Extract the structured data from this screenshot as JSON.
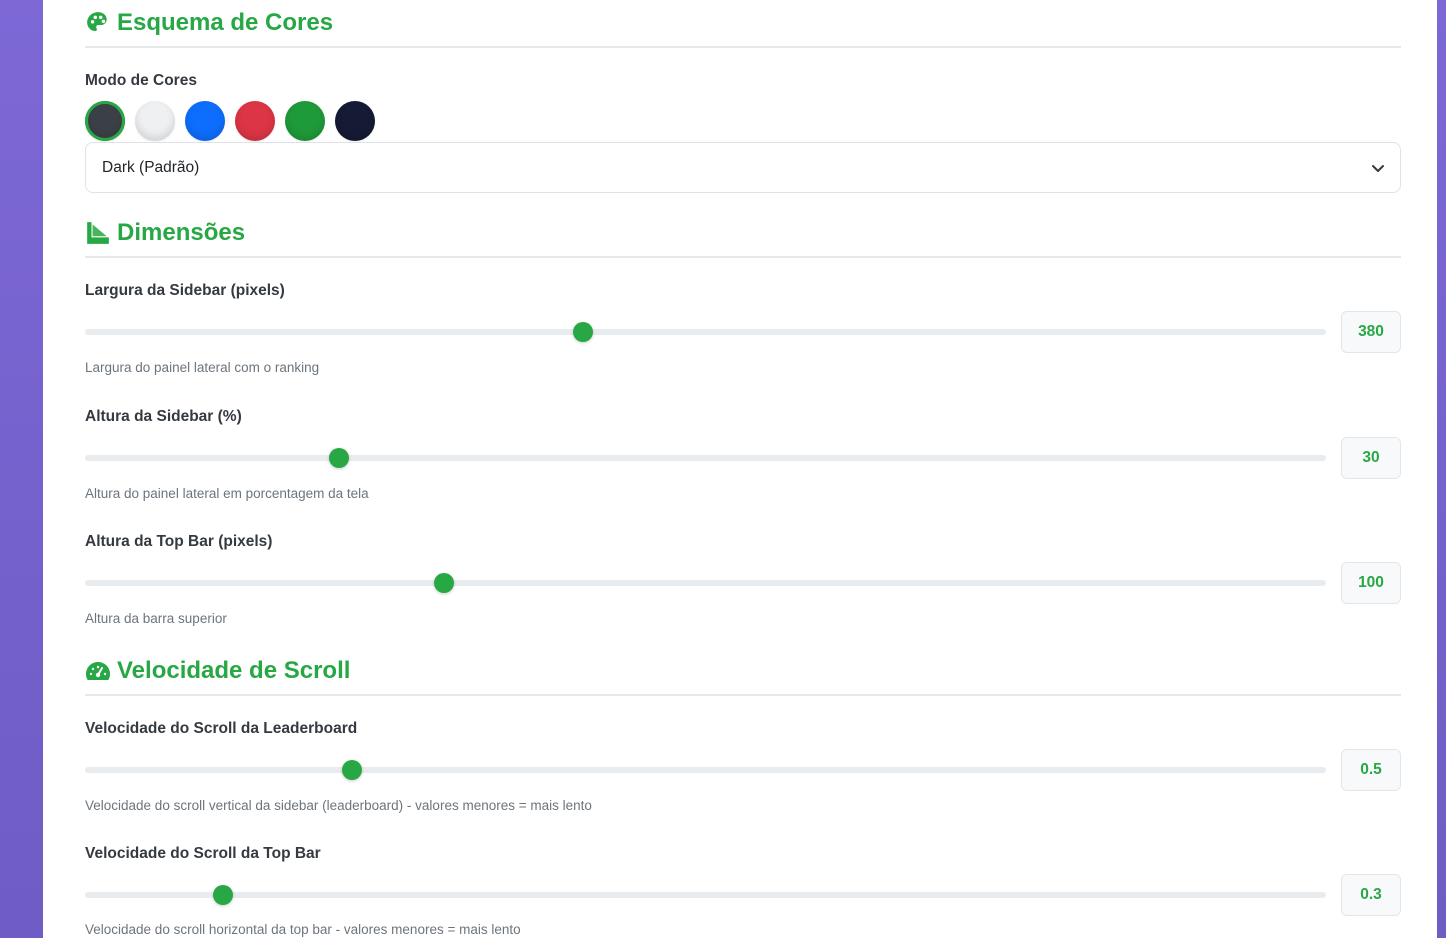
{
  "colors": {
    "accent": "#28a745",
    "background_gradient": "#7d68d6"
  },
  "color_scheme": {
    "title": "Esquema de Cores",
    "icon": "palette-icon",
    "mode_label": "Modo de Cores",
    "swatches": [
      {
        "name": "dark",
        "color": "#3b3f46",
        "selected": true
      },
      {
        "name": "light",
        "color": "#eef0f2",
        "selected": false
      },
      {
        "name": "blue",
        "color": "#0d6efd",
        "selected": false
      },
      {
        "name": "red",
        "color": "#dc3545",
        "selected": false
      },
      {
        "name": "green",
        "color": "#1f9a3a",
        "selected": false
      },
      {
        "name": "navy",
        "color": "#151b34",
        "selected": false
      }
    ],
    "select_value": "Dark (Padrão)"
  },
  "dimensions": {
    "title": "Dimensões",
    "icon": "ruler-icon",
    "sidebar_width": {
      "label": "Largura da Sidebar (pixels)",
      "value": "380",
      "fraction": 0.401,
      "help": "Largura do painel lateral com o ranking"
    },
    "sidebar_height": {
      "label": "Altura da Sidebar (%)",
      "value": "30",
      "fraction": 0.205,
      "help": "Altura do painel lateral em porcentagem da tela"
    },
    "topbar_height": {
      "label": "Altura da Top Bar (pixels)",
      "value": "100",
      "fraction": 0.289,
      "help": "Altura da barra superior"
    }
  },
  "scroll_speed": {
    "title": "Velocidade de Scroll",
    "icon": "speedometer-icon",
    "leaderboard": {
      "label": "Velocidade do Scroll da Leaderboard",
      "value": "0.5",
      "fraction": 0.215,
      "help": "Velocidade do scroll vertical da sidebar (leaderboard) - valores menores = mais lento"
    },
    "topbar": {
      "label": "Velocidade do Scroll da Top Bar",
      "value": "0.3",
      "fraction": 0.111,
      "help": "Velocidade do scroll horizontal da top bar - valores menores = mais lento"
    }
  }
}
